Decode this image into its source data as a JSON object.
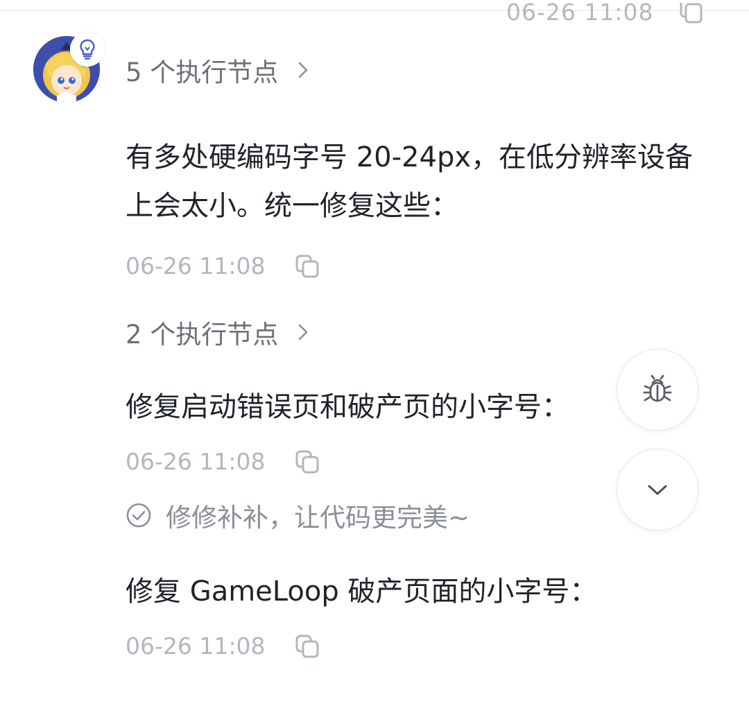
{
  "top": {
    "timestamp": "06-26 11:08"
  },
  "avatar": {
    "badge_icon": "lightbulb-icon"
  },
  "groups": [
    {
      "nodes_label": "5 个执行节点"
    },
    {
      "nodes_label": "2 个执行节点"
    }
  ],
  "messages": [
    {
      "text": "有多处硬编码字号 20-24px，在低分辨率设备上会太小。统一修复这些：",
      "timestamp": "06-26 11:08"
    },
    {
      "text": "修复启动错误页和破产页的小字号：",
      "timestamp": "06-26 11:08"
    },
    {
      "text": "修复 GameLoop 破产页面的小字号：",
      "timestamp": "06-26 11:08"
    }
  ],
  "fix_status": {
    "text": "修修补补，让代码更完美~"
  },
  "fabs": {
    "bug_icon": "bug-icon",
    "scroll_icon": "chevron-down-icon"
  },
  "colors": {
    "text_primary": "#1f2329",
    "text_secondary": "#6b7078",
    "text_muted": "#b2b6bd",
    "accent": "#4a5bd4"
  }
}
